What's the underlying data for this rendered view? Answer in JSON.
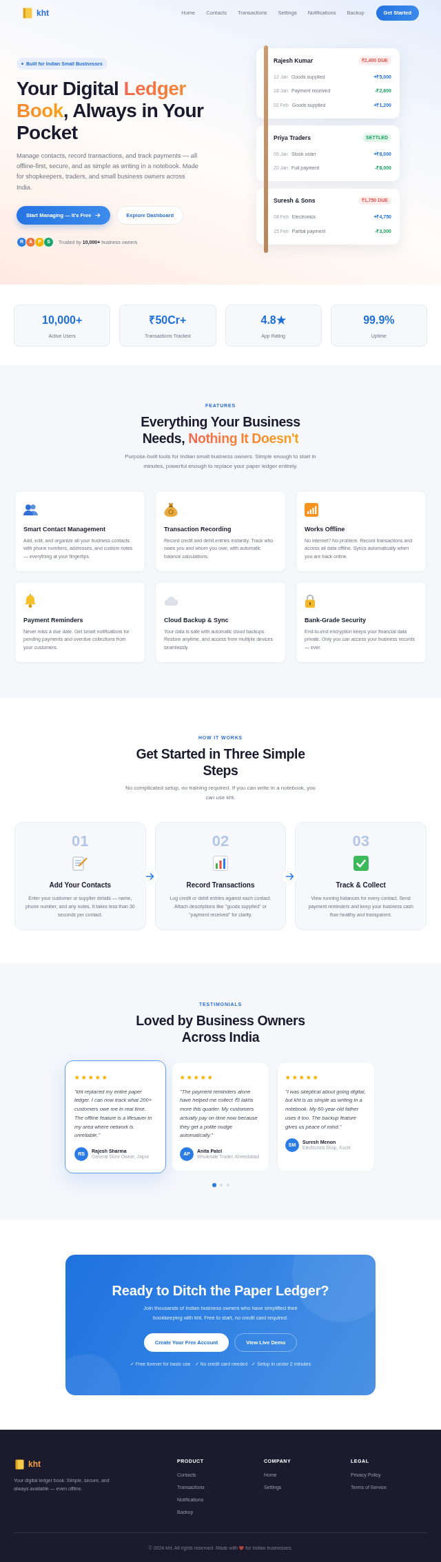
{
  "header": {
    "logo": "kht",
    "nav": [
      "Home",
      "Contacts",
      "Transactions",
      "Settings",
      "Notifications",
      "Backup"
    ],
    "cta": "Get Started"
  },
  "hero": {
    "badge": "Built for Indian Small Businesses",
    "title": [
      {
        "text": "Your Digital ",
        "highlight": false
      },
      {
        "text": "Ledger Book",
        "highlight": true
      },
      {
        "text": ", Always in Your Pocket",
        "highlight": false
      }
    ],
    "description": "Manage contacts, record transactions, and track payments — all offline-first, secure, and as simple as writing in a notebook. Made for shopkeepers, traders, and small business owners across India.",
    "buttons": [
      {
        "label": "Start Managing — It's Free",
        "kind": "primary"
      },
      {
        "label": "Explore Dashboard",
        "kind": "secondary"
      }
    ],
    "trusted": {
      "avatars": [
        {
          "initial": "R",
          "color": "#2f7de1"
        },
        {
          "initial": "A",
          "color": "#f0763f"
        },
        {
          "initial": "P",
          "color": "#f4b400"
        },
        {
          "initial": "S",
          "color": "#18a36a"
        }
      ],
      "text": "Trusted by **10,000+** business owners"
    }
  },
  "ledger_cards": [
    {
      "name": "Rajesh Kumar",
      "status": {
        "label": "₹2,400 DUE",
        "kind": "due"
      },
      "entries": [
        {
          "date": "12 Jan",
          "description": "Goods supplied",
          "amount": "+₹5,000",
          "kind": "credit"
        },
        {
          "date": "18 Jan",
          "description": "Payment received",
          "amount": "-₹2,600",
          "kind": "debit"
        },
        {
          "date": "02 Feb",
          "description": "Goods supplied",
          "amount": "+₹1,200",
          "kind": "credit"
        }
      ]
    },
    {
      "name": "Priya Traders",
      "status": {
        "label": "SETTLED",
        "kind": "settled"
      },
      "entries": [
        {
          "date": "05 Jan",
          "description": "Stock order",
          "amount": "+₹8,000",
          "kind": "credit"
        },
        {
          "date": "20 Jan",
          "description": "Full payment",
          "amount": "-₹8,000",
          "kind": "debit"
        }
      ]
    },
    {
      "name": "Suresh & Sons",
      "status": {
        "label": "₹1,750 DUE",
        "kind": "due"
      },
      "entries": [
        {
          "date": "08 Feb",
          "description": "Electronics",
          "amount": "+₹4,750",
          "kind": "credit"
        },
        {
          "date": "15 Feb",
          "description": "Partial payment",
          "amount": "-₹3,000",
          "kind": "debit"
        }
      ]
    }
  ],
  "stats": [
    {
      "value": "10,000+",
      "label": "Active Users"
    },
    {
      "value": "₹50Cr+",
      "label": "Transactions Tracked"
    },
    {
      "value": "4.8★",
      "label": "App Rating"
    },
    {
      "value": "99.9%",
      "label": "Uptime"
    }
  ],
  "features": {
    "eyebrow": "FEATURES",
    "title": [
      {
        "text": "Everything Your Business Needs, ",
        "highlight": false
      },
      {
        "text": "Nothing It Doesn't",
        "highlight": true
      }
    ],
    "subtitle": "Purpose-built tools for Indian small business owners. Simple enough to start in minutes, powerful enough to replace your paper ledger entirely.",
    "items": [
      {
        "title": "Smart Contact Management",
        "description": "Add, edit, and organize all your business contacts with phone numbers, addresses, and custom notes — everything at your fingertips."
      },
      {
        "title": "Transaction Recording",
        "description": "Record credit and debit entries instantly. Track who owes you and whom you owe, with automatic balance calculations."
      },
      {
        "title": "Works Offline",
        "description": "No internet? No problem. Record transactions and access all data offline. Syncs automatically when you are back online."
      },
      {
        "title": "Payment Reminders",
        "description": "Never miss a due date. Get smart notifications for pending payments and overdue collections from your customers."
      },
      {
        "title": "Cloud Backup & Sync",
        "description": "Your data is safe with automatic cloud backups. Restore anytime, and access from multiple devices seamlessly."
      },
      {
        "title": "Bank-Grade Security",
        "description": "End-to-end encryption keeps your financial data private. Only you can access your business records — ever."
      }
    ]
  },
  "how_it_works": {
    "eyebrow": "HOW IT WORKS",
    "title": "Get Started in Three Simple Steps",
    "subtitle": "No complicated setup, no training required. If you can write in a notebook, you can use kht.",
    "steps": [
      {
        "number": "01",
        "title": "Add Your Contacts",
        "description": "Enter your customer or supplier details — name, phone number, and any notes. It takes less than 30 seconds per contact."
      },
      {
        "number": "02",
        "title": "Record Transactions",
        "description": "Log credit or debit entries against each contact. Attach descriptions like \"goods supplied\" or \"payment received\" for clarity."
      },
      {
        "number": "03",
        "title": "Track & Collect",
        "description": "View running balances for every contact. Send payment reminders and keep your business cash flow healthy and transparent."
      }
    ]
  },
  "testimonials": {
    "eyebrow": "TESTIMONIALS",
    "title": "Loved by Business Owners Across India",
    "items": [
      {
        "selected": true,
        "stars": 5,
        "quote": "\"kht replaced my entire paper ledger. I can now track what 200+ customers owe me in real time. The offline feature is a lifesaver in my area where network is unreliable.\"",
        "initials": "RS",
        "name": "Rajesh Sharma",
        "role": "General Store Owner, Jaipur"
      },
      {
        "selected": false,
        "stars": 5,
        "quote": "\"The payment reminders alone have helped me collect ₹3 lakhs more this quarter. My customers actually pay on time now because they get a polite nudge automatically.\"",
        "initials": "AP",
        "name": "Anita Patel",
        "role": "Wholesale Trader, Ahmedabad"
      },
      {
        "selected": false,
        "stars": 5,
        "quote": "\"I was skeptical about going digital, but kht is as simple as writing in a notebook. My 60-year-old father uses it too. The backup feature gives us peace of mind.\"",
        "initials": "SM",
        "name": "Suresh Menon",
        "role": "Electronics Shop, Kochi"
      }
    ],
    "dots": [
      {
        "selected": true
      },
      {
        "selected": false
      },
      {
        "selected": false
      }
    ]
  },
  "cta": {
    "title": "Ready to Ditch the Paper Ledger?",
    "subtitle": "Join thousands of Indian business owners who have simplified their bookkeeping with kht. Free to start, no credit card required.",
    "buttons": [
      {
        "label": "Create Your Free Account",
        "kind": "primary"
      },
      {
        "label": "View Live Demo",
        "kind": "secondary"
      }
    ],
    "notes": [
      "✓ Free forever for basic use",
      "✓ No credit card needed",
      "✓ Setup in under 2 minutes"
    ]
  },
  "footer": {
    "logo": "kht",
    "description": "Your digital ledger book. Simple, secure, and always available — even offline.",
    "columns": [
      {
        "heading": "PRODUCT",
        "links": [
          "Contacts",
          "Transactions",
          "Notifications",
          "Backup"
        ]
      },
      {
        "heading": "COMPANY",
        "links": [
          "Home",
          "Settings"
        ]
      },
      {
        "heading": "LEGAL",
        "links": [
          "Privacy Policy",
          "Terms of Service"
        ]
      }
    ],
    "copyright": {
      "before": "© 2024 kht. All rights reserved. Made with",
      "after": "for Indian businesses."
    }
  }
}
